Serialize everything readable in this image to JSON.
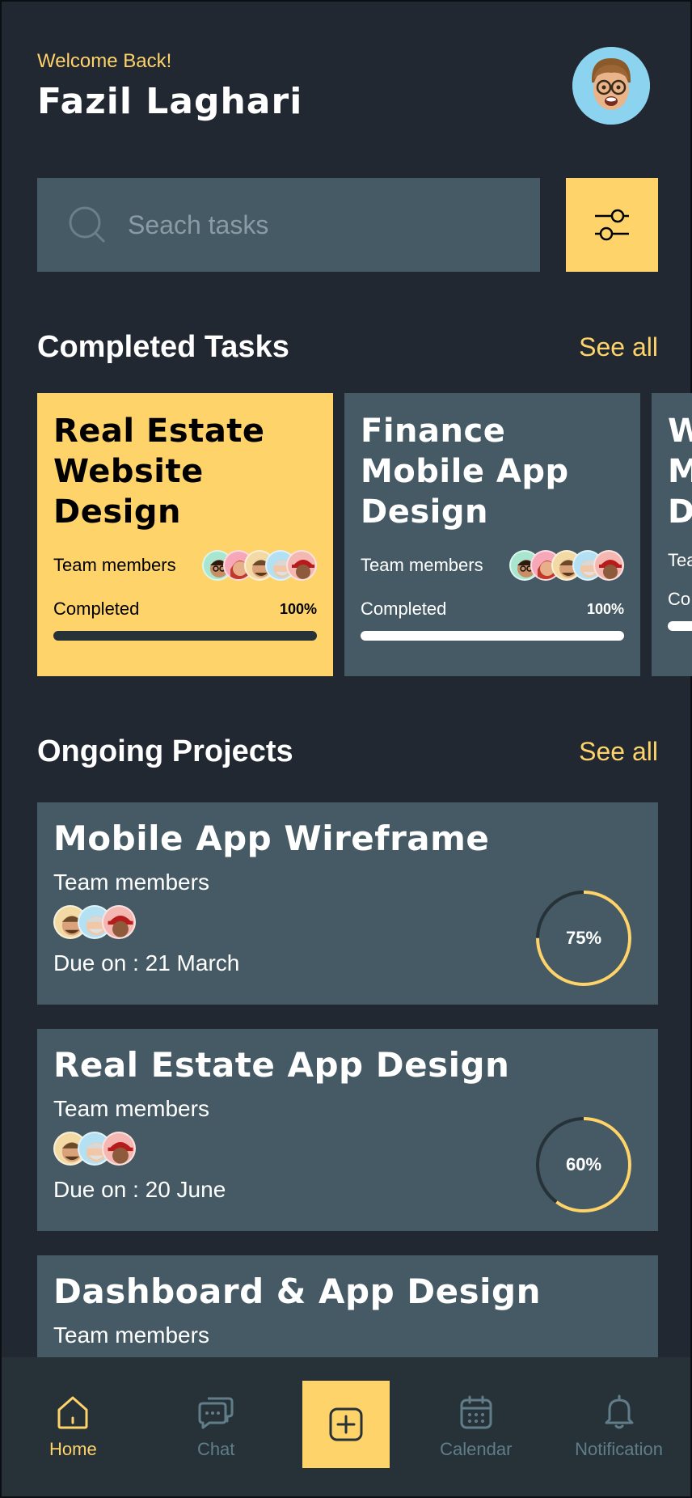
{
  "header": {
    "welcome": "Welcome Back!",
    "username": "Fazil Laghari"
  },
  "search": {
    "placeholder": "Seach tasks"
  },
  "completed_section": {
    "title": "Completed Tasks",
    "see_all": "See all",
    "cards": [
      {
        "title_lines": [
          "Real Estate",
          "Website",
          "Design"
        ],
        "team_label": "Team members",
        "status": "Completed",
        "progress": "100%"
      },
      {
        "title_lines": [
          "Finance",
          "Mobile App",
          "Design"
        ],
        "team_label": "Team members",
        "status": "Completed",
        "progress": "100%"
      },
      {
        "title_lines": [
          "W",
          "M",
          "D"
        ],
        "team_label": "Tea",
        "status": "Co"
      }
    ]
  },
  "ongoing_section": {
    "title": "Ongoing Projects",
    "see_all": "See all",
    "projects": [
      {
        "title": "Mobile App Wireframe",
        "team_label": "Team members",
        "due": "Due on : 21 March",
        "progress": "75%",
        "progress_value": 0.75
      },
      {
        "title": "Real Estate App Design",
        "team_label": "Team members",
        "due": "Due on : 20 June",
        "progress": "60%",
        "progress_value": 0.6
      },
      {
        "title": "Dashboard & App Design",
        "team_label": "Team members"
      }
    ]
  },
  "nav": {
    "home": "Home",
    "chat": "Chat",
    "calendar": "Calendar",
    "notification": "Notification"
  },
  "colors": {
    "background": "#212832",
    "card": "#455A64",
    "accent": "#FED36A",
    "nav_bg": "#263238",
    "muted": "#617D8A"
  }
}
